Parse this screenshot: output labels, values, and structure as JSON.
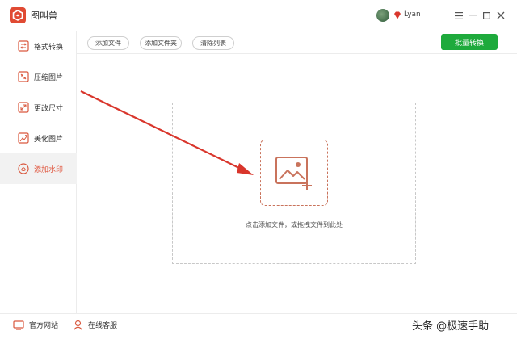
{
  "app": {
    "title": "图叫兽",
    "username": "Lyan"
  },
  "sidebar": {
    "items": [
      {
        "label": "格式转换",
        "icon": "format-convert-icon"
      },
      {
        "label": "压缩图片",
        "icon": "compress-image-icon"
      },
      {
        "label": "更改尺寸",
        "icon": "resize-icon"
      },
      {
        "label": "美化图片",
        "icon": "beautify-image-icon"
      },
      {
        "label": "添加水印",
        "icon": "watermark-icon",
        "active": true
      }
    ]
  },
  "toolbar": {
    "add_file": "添加文件",
    "add_folder": "添加文件夹",
    "clear_list": "清除列表",
    "batch_convert": "批量转换"
  },
  "dropzone": {
    "hint": "点击添加文件，或拖拽文件到此处"
  },
  "footer": {
    "official_site": "官方网站",
    "online_support": "在线客服",
    "watermark": "头条 @极速手助"
  },
  "colors": {
    "accent": "#e0573f",
    "primary_button": "#1eaa3c",
    "arrow": "#d9362c"
  }
}
